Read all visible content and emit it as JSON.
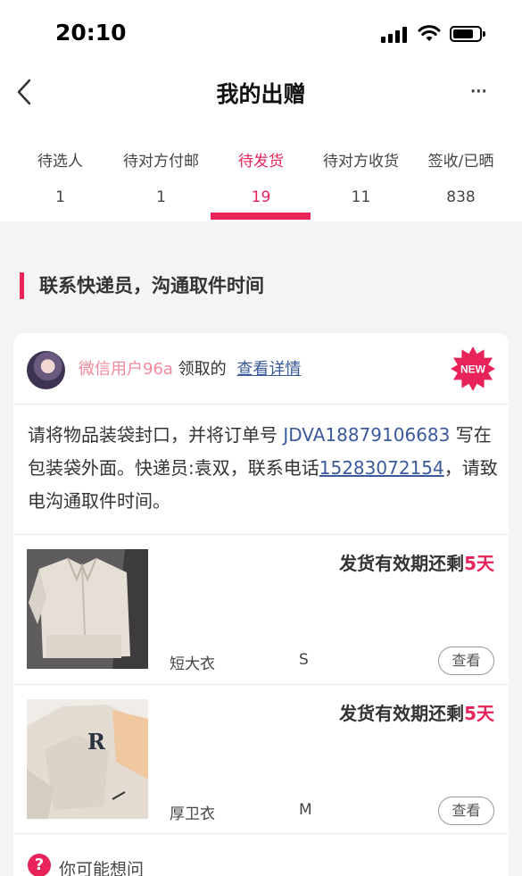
{
  "status_bar": {
    "time": "20:10"
  },
  "nav": {
    "title": "我的出赠",
    "more": "···"
  },
  "tabs": [
    {
      "label": "待选人",
      "count": "1",
      "active": false
    },
    {
      "label": "待对方付邮",
      "count": "1",
      "active": false
    },
    {
      "label": "待发货",
      "count": "19",
      "active": true
    },
    {
      "label": "待对方收货",
      "count": "11",
      "active": false
    },
    {
      "label": "签收/已晒",
      "count": "838",
      "active": false
    }
  ],
  "section": {
    "title": "联系快递员，沟通取件时间"
  },
  "card": {
    "user_name": "微信用户96a",
    "claimed_text": "领取的",
    "detail_link": "查看详情",
    "badge": "NEW",
    "instruction": {
      "part1": "请将物品装袋封口，并将订单号 ",
      "order_no": "JDVA18879106683",
      "part2": " 写在包装袋外面。快递员:袁双，联系电话",
      "phone": "15283072154",
      "part3": "，请致电沟通取件时间。"
    },
    "items": [
      {
        "deadline_prefix": "发货有效期还剩",
        "days": "5天",
        "name": "短大衣",
        "size": "S",
        "view": "查看"
      },
      {
        "deadline_prefix": "发货有效期还剩",
        "days": "5天",
        "name": "厚卫衣",
        "size": "M",
        "view": "查看"
      }
    ],
    "faq": {
      "label": "你可能想问"
    }
  },
  "colors": {
    "accent": "#e8235a",
    "link": "#3a5a9c",
    "username": "#f08a9c"
  }
}
